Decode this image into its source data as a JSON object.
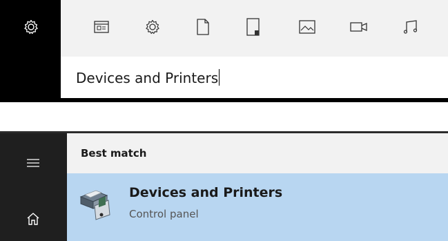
{
  "search": {
    "query": "Devices and Printers",
    "filters": [
      {
        "name": "apps-filter-icon"
      },
      {
        "name": "settings-filter-icon"
      },
      {
        "name": "documents-filter-icon"
      },
      {
        "name": "folders-filter-icon"
      },
      {
        "name": "photos-filter-icon"
      },
      {
        "name": "videos-filter-icon"
      },
      {
        "name": "music-filter-icon"
      }
    ]
  },
  "results": {
    "section_label": "Best match",
    "best_match": {
      "title": "Devices and Printers",
      "subtitle": "Control panel",
      "icon": "devices-and-printers-icon"
    }
  },
  "colors": {
    "rail": "#000000",
    "filter_bar": "#f2f2f2",
    "results_rail": "#1f1f1f",
    "selection": "#b8d6f1"
  }
}
